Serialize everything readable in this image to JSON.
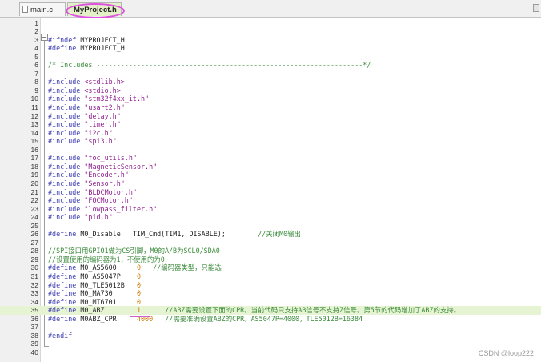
{
  "tabs": [
    {
      "label": "main.c",
      "active": false
    },
    {
      "label": "MyProject.h",
      "active": true
    }
  ],
  "colors": {
    "keyword": "#3b3bb0",
    "string": "#8e1b8e",
    "number": "#d07800",
    "comment": "#3a8a3a",
    "identifier": "#1e1e1e",
    "current_line_highlight": "#e7f4d4",
    "annotation": "#e050e0"
  },
  "code_lines": [
    {
      "n": "1",
      "parts": []
    },
    {
      "n": "2",
      "parts": []
    },
    {
      "n": "3",
      "parts": [
        [
          "kw",
          "#ifndef"
        ],
        [
          "id",
          " MYPROJECT_H"
        ]
      ]
    },
    {
      "n": "4",
      "parts": [
        [
          "kw",
          "#define"
        ],
        [
          "id",
          " MYPROJECT_H"
        ]
      ]
    },
    {
      "n": "5",
      "parts": []
    },
    {
      "n": "6",
      "parts": [
        [
          "cmt",
          "/* Includes ------------------------------------------------------------------*/"
        ]
      ]
    },
    {
      "n": "7",
      "parts": []
    },
    {
      "n": "8",
      "parts": [
        [
          "kw",
          "#include"
        ],
        [
          "id",
          " "
        ],
        [
          "str",
          "<stdlib.h>"
        ]
      ]
    },
    {
      "n": "9",
      "parts": [
        [
          "kw",
          "#include"
        ],
        [
          "id",
          " "
        ],
        [
          "str",
          "<stdio.h>"
        ]
      ]
    },
    {
      "n": "10",
      "parts": [
        [
          "kw",
          "#include"
        ],
        [
          "id",
          " "
        ],
        [
          "str",
          "\"stm32f4xx_it.h\""
        ]
      ]
    },
    {
      "n": "11",
      "parts": [
        [
          "kw",
          "#include"
        ],
        [
          "id",
          " "
        ],
        [
          "str",
          "\"usart2.h\""
        ]
      ]
    },
    {
      "n": "12",
      "parts": [
        [
          "kw",
          "#include"
        ],
        [
          "id",
          " "
        ],
        [
          "str",
          "\"delay.h\""
        ]
      ]
    },
    {
      "n": "13",
      "parts": [
        [
          "kw",
          "#include"
        ],
        [
          "id",
          " "
        ],
        [
          "str",
          "\"timer.h\""
        ]
      ]
    },
    {
      "n": "14",
      "parts": [
        [
          "kw",
          "#include"
        ],
        [
          "id",
          " "
        ],
        [
          "str",
          "\"i2c.h\""
        ]
      ]
    },
    {
      "n": "15",
      "parts": [
        [
          "kw",
          "#include"
        ],
        [
          "id",
          " "
        ],
        [
          "str",
          "\"spi3.h\""
        ]
      ]
    },
    {
      "n": "16",
      "parts": []
    },
    {
      "n": "17",
      "parts": [
        [
          "kw",
          "#include"
        ],
        [
          "id",
          " "
        ],
        [
          "str",
          "\"foc_utils.h\""
        ]
      ]
    },
    {
      "n": "18",
      "parts": [
        [
          "kw",
          "#include"
        ],
        [
          "id",
          " "
        ],
        [
          "str",
          "\"MagneticSensor.h\""
        ]
      ]
    },
    {
      "n": "19",
      "parts": [
        [
          "kw",
          "#include"
        ],
        [
          "id",
          " "
        ],
        [
          "str",
          "\"Encoder.h\""
        ]
      ]
    },
    {
      "n": "20",
      "parts": [
        [
          "kw",
          "#include"
        ],
        [
          "id",
          " "
        ],
        [
          "str",
          "\"Sensor.h\""
        ]
      ]
    },
    {
      "n": "21",
      "parts": [
        [
          "kw",
          "#include"
        ],
        [
          "id",
          " "
        ],
        [
          "str",
          "\"BLDCMotor.h\""
        ]
      ]
    },
    {
      "n": "22",
      "parts": [
        [
          "kw",
          "#include"
        ],
        [
          "id",
          " "
        ],
        [
          "str",
          "\"FOCMotor.h\""
        ]
      ]
    },
    {
      "n": "23",
      "parts": [
        [
          "kw",
          "#include"
        ],
        [
          "id",
          " "
        ],
        [
          "str",
          "\"lowpass_filter.h\""
        ]
      ]
    },
    {
      "n": "24",
      "parts": [
        [
          "kw",
          "#include"
        ],
        [
          "id",
          " "
        ],
        [
          "str",
          "\"pid.h\""
        ]
      ]
    },
    {
      "n": "25",
      "parts": []
    },
    {
      "n": "26",
      "parts": [
        [
          "kw",
          "#define"
        ],
        [
          "id",
          " M0_Disable   TIM_Cmd(TIM1, DISABLE);        "
        ],
        [
          "cmt",
          "//关闭M0输出"
        ]
      ]
    },
    {
      "n": "27",
      "parts": []
    },
    {
      "n": "28",
      "parts": [
        [
          "cmt",
          "//SPI接口用GPIO1做为CS引脚，M0的A/B为SCL0/SDA0"
        ]
      ]
    },
    {
      "n": "29",
      "parts": [
        [
          "cmt",
          "//设置使用的编码器为1，不使用的为0"
        ]
      ]
    },
    {
      "n": "30",
      "parts": [
        [
          "kw",
          "#define"
        ],
        [
          "id",
          " M0_AS5600     "
        ],
        [
          "num",
          "0"
        ],
        [
          "id",
          "   "
        ],
        [
          "cmt",
          "//编码器类型，只能选一"
        ]
      ]
    },
    {
      "n": "31",
      "parts": [
        [
          "kw",
          "#define"
        ],
        [
          "id",
          " M0_AS5047P    "
        ],
        [
          "num",
          "0"
        ]
      ]
    },
    {
      "n": "32",
      "parts": [
        [
          "kw",
          "#define"
        ],
        [
          "id",
          " M0_TLE5012B   "
        ],
        [
          "num",
          "0"
        ]
      ]
    },
    {
      "n": "33",
      "parts": [
        [
          "kw",
          "#define"
        ],
        [
          "id",
          " M0_MA730      "
        ],
        [
          "num",
          "0"
        ]
      ]
    },
    {
      "n": "34",
      "parts": [
        [
          "kw",
          "#define"
        ],
        [
          "id",
          " M0_MT6701     "
        ],
        [
          "num",
          "0"
        ]
      ]
    },
    {
      "n": "35",
      "parts": [
        [
          "kw",
          "#define"
        ],
        [
          "id",
          " M0_ABZ        "
        ],
        [
          "num",
          "1"
        ],
        [
          "id",
          "      "
        ],
        [
          "cmt",
          "//ABZ需要设置下面的CPR。当前代码只支持AB信号不支持Z信号。第5节的代码增加了ABZ的支持。"
        ]
      ],
      "highlight": true
    },
    {
      "n": "36",
      "parts": [
        [
          "kw",
          "#define"
        ],
        [
          "id",
          " M0ABZ_CPR     "
        ],
        [
          "num",
          "4000"
        ],
        [
          "id",
          "   "
        ],
        [
          "cmt",
          "//需要准确设置ABZ的CPR。AS5047P=4000，TLE5012B=16384"
        ]
      ]
    },
    {
      "n": "37",
      "parts": []
    },
    {
      "n": "38",
      "parts": [
        [
          "kw",
          "#endif"
        ]
      ]
    },
    {
      "n": "39",
      "parts": []
    },
    {
      "n": "40",
      "parts": []
    }
  ],
  "watermark": "CSDN @loop222"
}
